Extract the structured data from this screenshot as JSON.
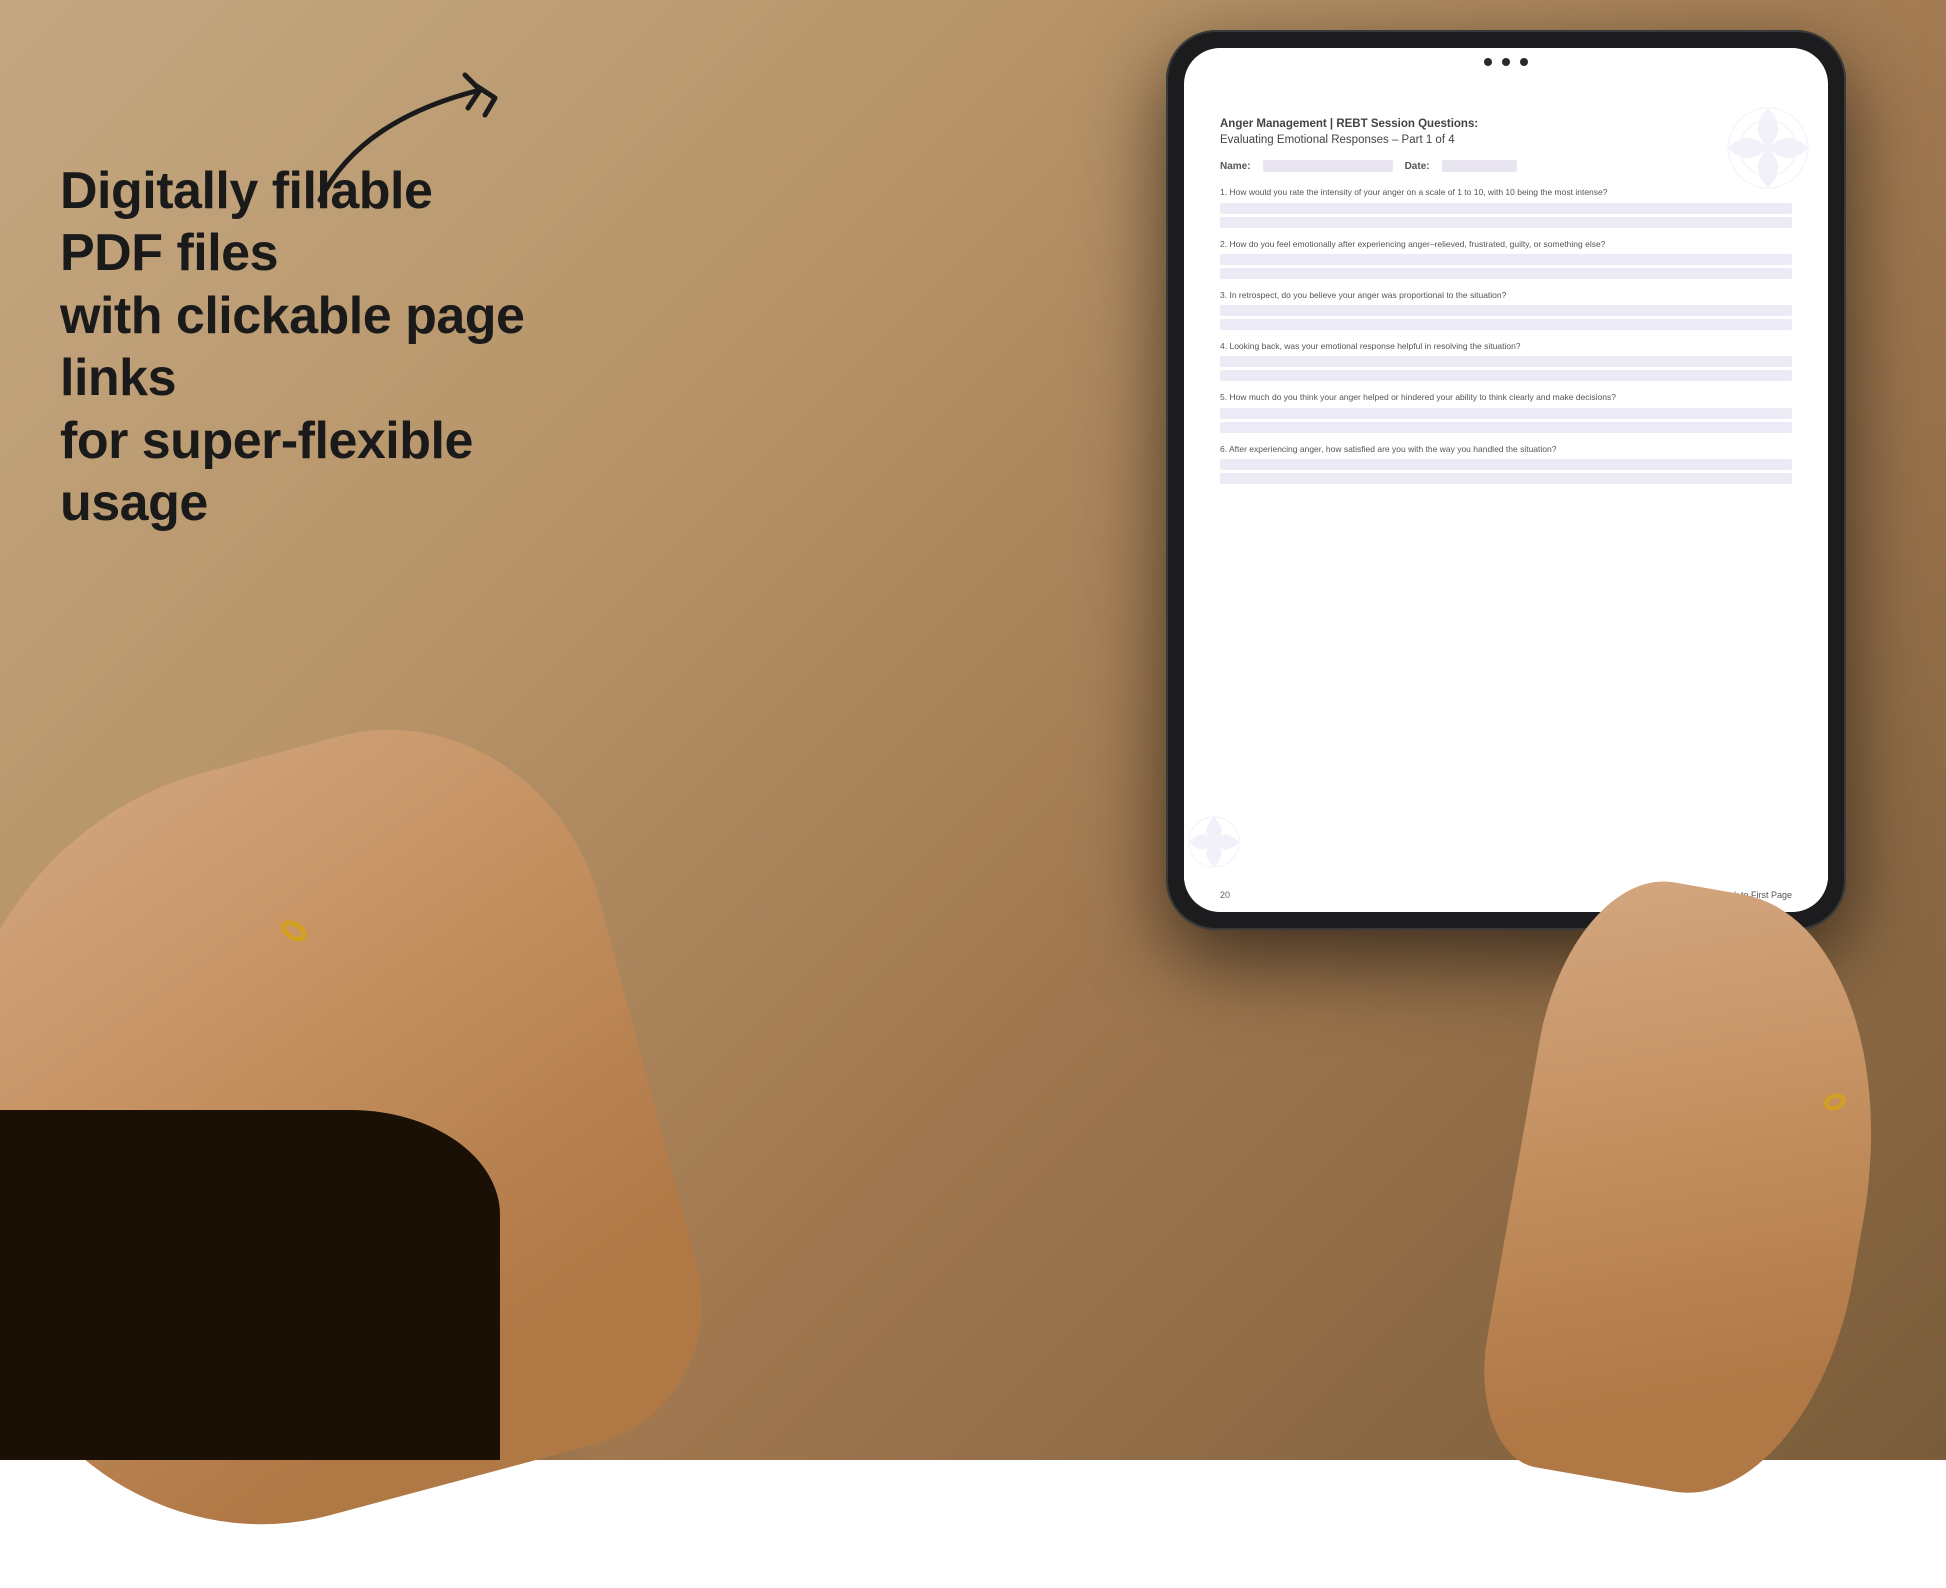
{
  "background": {
    "color_start": "#c4a882",
    "color_end": "#7a5c3a"
  },
  "left_panel": {
    "main_text": "Digitally fillable PDF files\nwith clickable page links\nfor super-flexible usage"
  },
  "arrow": {
    "label": "curved-arrow"
  },
  "tablet": {
    "camera_dots": 3
  },
  "pdf": {
    "title_line1": "Anger Management | REBT Session Questions:",
    "title_line2": "Evaluating Emotional Responses  – Part 1 of 4",
    "name_label": "Name:",
    "date_label": "Date:",
    "questions": [
      {
        "number": "1.",
        "text": "How would you rate the intensity of your anger on a scale of 1 to 10, with 10 being the most intense?"
      },
      {
        "number": "2.",
        "text": "How do you feel emotionally after experiencing anger–relieved, frustrated, guilty, or something else?"
      },
      {
        "number": "3.",
        "text": "In retrospect, do you believe your anger was proportional to the situation?"
      },
      {
        "number": "4.",
        "text": "Looking back, was your emotional response helpful in resolving the situation?"
      },
      {
        "number": "5.",
        "text": "How much do you think your anger helped or hindered your ability to think clearly and make decisions?"
      },
      {
        "number": "6.",
        "text": "After experiencing anger, how satisfied are you with the way you handled the situation?"
      }
    ],
    "footer_page": "20",
    "footer_link": "↑ Back to First Page"
  }
}
